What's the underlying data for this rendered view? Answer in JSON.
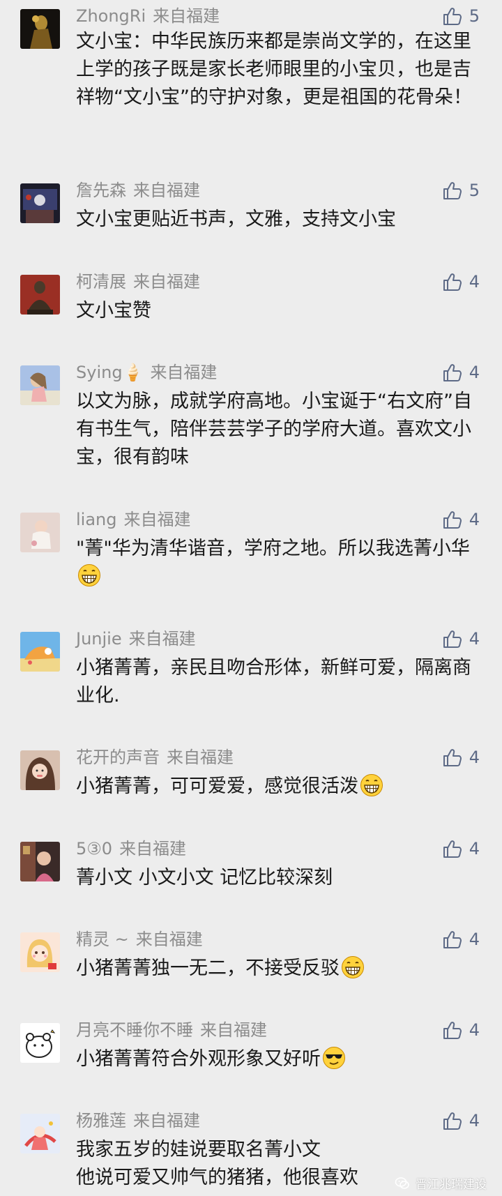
{
  "colors": {
    "background": "#ededed",
    "name": "#8c8c8c",
    "text": "#191919",
    "like": "#5d6a86"
  },
  "comments": [
    {
      "name": "ZhongRi",
      "location": "来自福建",
      "likes": "5",
      "text": "文小宝：中华民族历来都是崇尚文学的，在这里上学的孩子既是家长老师眼里的小宝贝，也是吉祥物“文小宝”的守护对象，更是祖国的花骨朵！",
      "emoji": ""
    },
    {
      "name": "詹先森",
      "location": "来自福建",
      "likes": "5",
      "text": "文小宝更贴近书声，文雅，支持文小宝",
      "emoji": ""
    },
    {
      "name": "柯清展",
      "location": "来自福建",
      "likes": "4",
      "text": "文小宝赞",
      "emoji": ""
    },
    {
      "name": "Sying🍦",
      "location": "来自福建",
      "likes": "4",
      "text": "以文为脉，成就学府高地。小宝诞于“右文府”自有书生气，陪伴芸芸学子的学府大道。喜欢文小宝，很有韵味",
      "emoji": ""
    },
    {
      "name": "liang",
      "location": "来自福建",
      "likes": "4",
      "text": "\"菁\"华为清华谐音，学府之地。所以我选菁小华",
      "emoji": "grin"
    },
    {
      "name": "Junjie",
      "location": "来自福建",
      "likes": "4",
      "text": "小猪菁菁，亲民且吻合形体，新鲜可爱，隔离商业化.",
      "emoji": ""
    },
    {
      "name": "花开的声音",
      "location": "来自福建",
      "likes": "4",
      "text": "小猪菁菁，可可爱爱，感觉很活泼",
      "emoji": "grin"
    },
    {
      "name": "5③0",
      "location": "来自福建",
      "likes": "4",
      "text": "菁小文 小文小文 记忆比较深刻",
      "emoji": ""
    },
    {
      "name": "精灵 ~",
      "location": "来自福建",
      "likes": "4",
      "text": "小猪菁菁独一无二，不接受反驳",
      "emoji": "grin"
    },
    {
      "name": "月亮不睡你不睡",
      "location": "来自福建",
      "likes": "4",
      "text": "小猪菁菁符合外观形象又好听",
      "emoji": "cool"
    },
    {
      "name": "杨雅莲",
      "location": "来自福建",
      "likes": "4",
      "text": "我家五岁的娃说要取名菁小文\n他说可爱又帅气的猪猪，他很喜欢",
      "emoji": ""
    }
  ],
  "watermark": "晋江兆瑞建设"
}
